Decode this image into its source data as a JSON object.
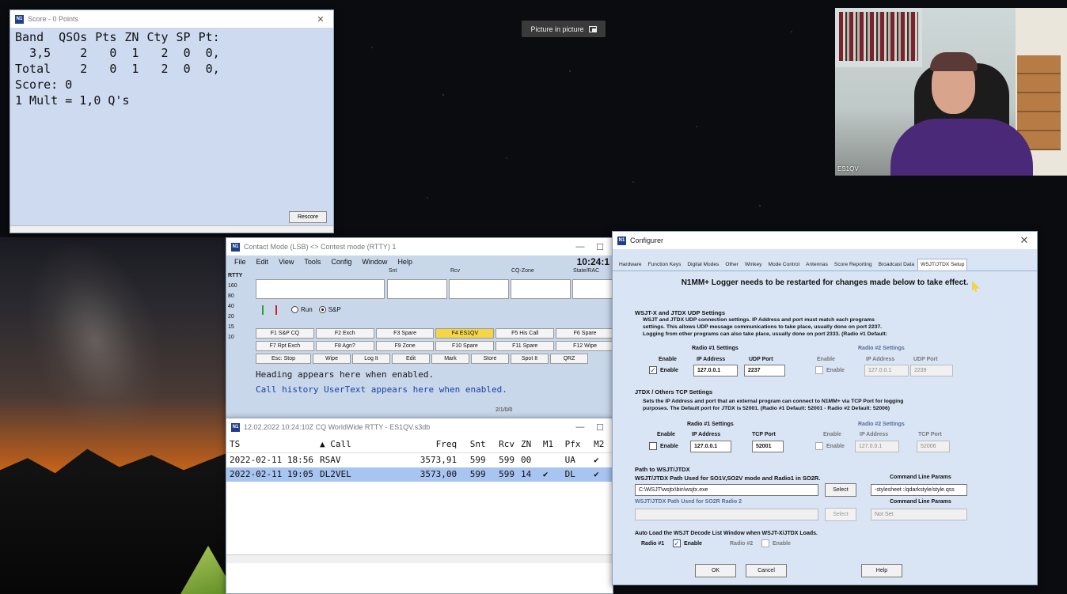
{
  "pip": {
    "label": "Picture in picture"
  },
  "webcam": {
    "name": "ES1QV"
  },
  "score_window": {
    "title": "Score - 0 Points",
    "headers": [
      "Band",
      "QSOs",
      "Pts",
      "ZN",
      "Cty",
      "SP",
      "Pt:"
    ],
    "rows": [
      [
        "3,5",
        "2",
        "0",
        "1",
        "2",
        "0",
        "0,"
      ],
      [
        "Total",
        "2",
        "0",
        "1",
        "2",
        "0",
        "0,"
      ]
    ],
    "score_line": "Score: 0",
    "mult_line": "1 Mult = 1,0 Q's",
    "rescore_label": "Rescore"
  },
  "entry_window": {
    "title": "Contact Mode (LSB) <> Contest mode (RTTY) 1",
    "menu": [
      "File",
      "Edit",
      "View",
      "Tools",
      "Config",
      "Window",
      "Help"
    ],
    "clock": "10:24:1",
    "mode": "RTTY",
    "bands": [
      "160",
      "80",
      "40",
      "20",
      "15",
      "10"
    ],
    "field_labels": [
      "Snt",
      "Rcv",
      "CQ-Zone",
      "State/RAC"
    ],
    "run_label": "Run",
    "sp_label": "S&P",
    "fkeys_row1": [
      "F1 S&P CQ",
      "F2 Exch",
      "F3 Spare",
      "F4 ES1QV",
      "F5 His Call",
      "F6 Spare"
    ],
    "fkeys_row2": [
      "F7 Rpt Exch",
      "F8 Agn?",
      "F9 Zone",
      "F10 Spare",
      "F11 Spare",
      "F12 Wipe"
    ],
    "fkeys_row3": [
      "Esc: Stop",
      "Wipe",
      "Log It",
      "Edit",
      "Mark",
      "Store",
      "Spot It",
      "QRZ"
    ],
    "heading_text": "Heading appears here when enabled.",
    "call_history_text": "Call history UserText appears here when enabled.",
    "status": "2/1/0/0"
  },
  "log_window": {
    "title": "12.02.2022 10:24:10Z  CQ WorldWide RTTY - ES1QV.s3db",
    "columns": [
      "TS",
      "Call",
      "Freq",
      "Snt",
      "Rcv",
      "ZN",
      "M1",
      "Pfx",
      "M2"
    ],
    "rows": [
      {
        "ts": "2022-02-11 18:56",
        "call": "RSAV",
        "freq": "3573,91",
        "snt": "599",
        "rcv": "599",
        "zn": "00",
        "m1": "",
        "pfx": "UA",
        "m2": "✔"
      },
      {
        "ts": "2022-02-11 19:05",
        "call": "DL2VEL",
        "freq": "3573,00",
        "snt": "599",
        "rcv": "599",
        "zn": "14",
        "m1": "✔",
        "pfx": "DL",
        "m2": "✔"
      }
    ]
  },
  "configurer": {
    "title": "Configurer",
    "tabs": [
      "Hardware",
      "Function Keys",
      "Digital Modes",
      "Other",
      "Winkey",
      "Mode Control",
      "Antennas",
      "Score Reporting",
      "Broadcast Data",
      "WSJT/JTDX Setup"
    ],
    "warning": "N1MM+ Logger needs to be restarted for changes made below to take effect.",
    "udp": {
      "title": "WSJT-X and JTDX UDP Settings",
      "desc1": "WSJT and JTDX UDP connection settings. IP Address and port must match each programs",
      "desc2": "settings. This allows UDP message communications to take place, usually done on port 2237.",
      "desc3": "Logging from other programs can also take place, usually done on port 2333. (Radio #1 Default:",
      "radio1_title": "Radio #1 Settings",
      "radio2_title": "Radio #2 Settings",
      "enable_hdr": "Enable",
      "ip_hdr": "IP Address",
      "port_hdr": "UDP Port",
      "enable_label": "Enable",
      "r1_ip": "127.0.0.1",
      "r1_port": "2237",
      "r2_ip": "127.0.0.1",
      "r2_port": "2239"
    },
    "tcp": {
      "title": "JTDX / Others TCP Settings",
      "desc1": "Sets the IP Address and port that an external program can connect to N1MM+ via TCP Port for logging",
      "desc2": "purposes. The Default port for JTDX is 52001. (Radio #1 Default: 52001 - Radio #2 Default: 52006)",
      "radio1_title": "Radio #1 Settings",
      "radio2_title": "Radio #2 Settings",
      "enable_hdr": "Enable",
      "ip_hdr": "IP Address",
      "port_hdr": "TCP Port",
      "enable_label": "Enable",
      "r1_ip": "127.0.0.1",
      "r1_port": "52001",
      "r2_ip": "127.0.0.1",
      "r2_port": "52006"
    },
    "path": {
      "title": "Path to WSJT/JTDX",
      "label1": "WSJT/JTDX Path Used for SO1V,SO2V mode and Radio1 in SO2R.",
      "cmd_label": "Command Line Params",
      "path1": "C:\\WSJT\\wsjtx\\bin\\wsjtx.exe",
      "select_label": "Select",
      "cmd1": "-stylesheet :/qdarkstyle/style.qss",
      "label2": "WSJT/JTDX Path Used for SO2R Radio 2",
      "cmd_label2": "Command Line Params",
      "path2": "",
      "select_label2": "Select",
      "cmd2": "Not Set"
    },
    "autoload": {
      "title": "Auto Load the WSJT Decode List Window when WSJT-X/JTDX Loads.",
      "radio1": "Radio #1",
      "radio2": "Radio #2",
      "enable_label": "Enable"
    },
    "ok_label": "OK",
    "cancel_label": "Cancel",
    "help_label": "Help"
  }
}
